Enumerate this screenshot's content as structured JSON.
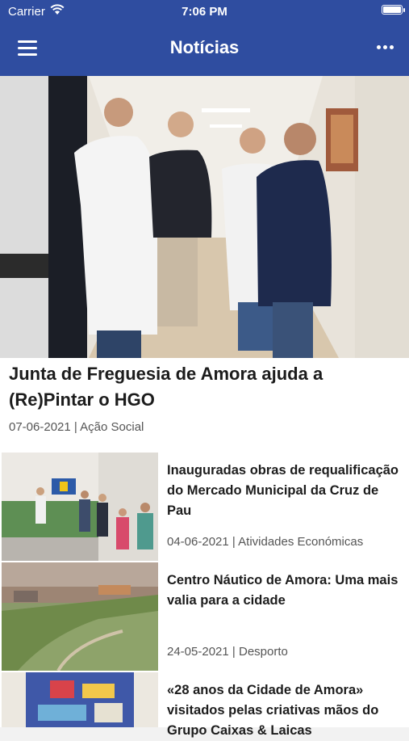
{
  "status_bar": {
    "carrier": "Carrier",
    "time": "7:06 PM"
  },
  "header": {
    "title": "Notícias"
  },
  "colors": {
    "header_bg": "#2f4da0",
    "text": "#1c1c1c",
    "meta": "#555555"
  },
  "icons": {
    "menu": "hamburger-menu-icon",
    "more": "more-options-icon",
    "wifi": "wifi-icon",
    "battery": "battery-icon"
  },
  "featured": {
    "title": "Junta de Freguesia de Amora ajuda a (Re)Pintar o HGO",
    "date": "07-06-2021",
    "separator": "|",
    "category": "Ação Social"
  },
  "articles": [
    {
      "title": "Inauguradas obras de requalificação do Mercado Municipal da Cruz de Pau",
      "date": "04-06-2021",
      "separator": "|",
      "category": "Atividades Económicas"
    },
    {
      "title": "Centro Náutico de Amora: Uma mais valia para  a cidade",
      "date": "24-05-2021",
      "separator": "|",
      "category": "Desporto"
    },
    {
      "title": "«28 anos da Cidade de Amora» visitados pelas criativas mãos do Grupo Caixas & Laicas",
      "date": "",
      "separator": "",
      "category": ""
    }
  ]
}
